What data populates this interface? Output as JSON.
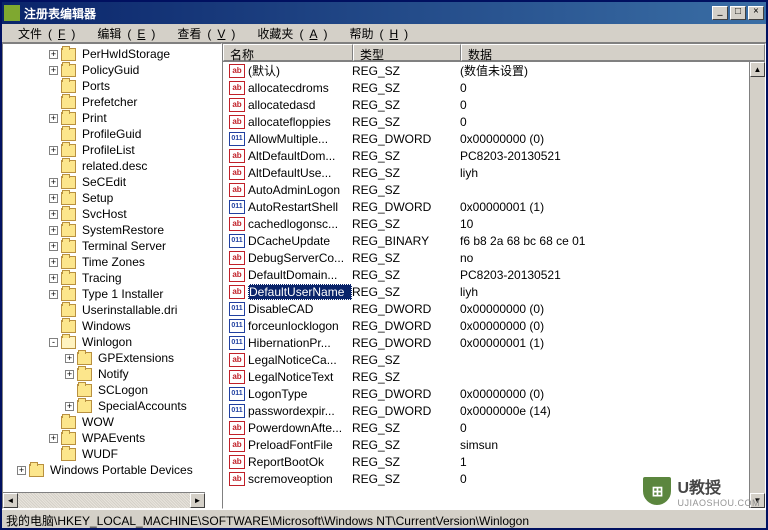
{
  "window": {
    "title": "注册表编辑器",
    "min_btn": "_",
    "max_btn": "□",
    "close_btn": "×"
  },
  "menu": {
    "file": "文件",
    "file_acc": "F",
    "edit": "编辑",
    "edit_acc": "E",
    "view": "查看",
    "view_acc": "V",
    "fav": "收藏夹",
    "fav_acc": "A",
    "help": "帮助",
    "help_acc": "H"
  },
  "columns": {
    "name": "名称",
    "type": "类型",
    "data": "数据"
  },
  "tree": [
    {
      "indent": 46,
      "exp": "+",
      "label": "PerHwIdStorage"
    },
    {
      "indent": 46,
      "exp": "+",
      "label": "PolicyGuid"
    },
    {
      "indent": 46,
      "exp": "",
      "label": "Ports"
    },
    {
      "indent": 46,
      "exp": "",
      "label": "Prefetcher"
    },
    {
      "indent": 46,
      "exp": "+",
      "label": "Print"
    },
    {
      "indent": 46,
      "exp": "",
      "label": "ProfileGuid"
    },
    {
      "indent": 46,
      "exp": "+",
      "label": "ProfileList"
    },
    {
      "indent": 46,
      "exp": "",
      "label": "related.desc"
    },
    {
      "indent": 46,
      "exp": "+",
      "label": "SeCEdit"
    },
    {
      "indent": 46,
      "exp": "+",
      "label": "Setup"
    },
    {
      "indent": 46,
      "exp": "+",
      "label": "SvcHost"
    },
    {
      "indent": 46,
      "exp": "+",
      "label": "SystemRestore"
    },
    {
      "indent": 46,
      "exp": "+",
      "label": "Terminal Server"
    },
    {
      "indent": 46,
      "exp": "+",
      "label": "Time Zones"
    },
    {
      "indent": 46,
      "exp": "+",
      "label": "Tracing"
    },
    {
      "indent": 46,
      "exp": "+",
      "label": "Type 1 Installer"
    },
    {
      "indent": 46,
      "exp": "",
      "label": "Userinstallable.dri"
    },
    {
      "indent": 46,
      "exp": "",
      "label": "Windows"
    },
    {
      "indent": 46,
      "exp": "-",
      "label": "Winlogon",
      "open": true
    },
    {
      "indent": 62,
      "exp": "+",
      "label": "GPExtensions"
    },
    {
      "indent": 62,
      "exp": "+",
      "label": "Notify"
    },
    {
      "indent": 62,
      "exp": "",
      "label": "SCLogon"
    },
    {
      "indent": 62,
      "exp": "+",
      "label": "SpecialAccounts"
    },
    {
      "indent": 46,
      "exp": "",
      "label": "WOW"
    },
    {
      "indent": 46,
      "exp": "+",
      "label": "WPAEvents"
    },
    {
      "indent": 46,
      "exp": "",
      "label": "WUDF"
    },
    {
      "indent": 14,
      "exp": "+",
      "label": "Windows Portable Devices"
    }
  ],
  "values": [
    {
      "icon": "sz",
      "name": "(默认)",
      "type": "REG_SZ",
      "data": "(数值未设置)"
    },
    {
      "icon": "sz",
      "name": "allocatecdroms",
      "type": "REG_SZ",
      "data": "0"
    },
    {
      "icon": "sz",
      "name": "allocatedasd",
      "type": "REG_SZ",
      "data": "0"
    },
    {
      "icon": "sz",
      "name": "allocatefloppies",
      "type": "REG_SZ",
      "data": "0"
    },
    {
      "icon": "dw",
      "name": "AllowMultiple...",
      "type": "REG_DWORD",
      "data": "0x00000000 (0)"
    },
    {
      "icon": "sz",
      "name": "AltDefaultDom...",
      "type": "REG_SZ",
      "data": "PC8203-20130521"
    },
    {
      "icon": "sz",
      "name": "AltDefaultUse...",
      "type": "REG_SZ",
      "data": "liyh"
    },
    {
      "icon": "sz",
      "name": "AutoAdminLogon",
      "type": "REG_SZ",
      "data": ""
    },
    {
      "icon": "dw",
      "name": "AutoRestartShell",
      "type": "REG_DWORD",
      "data": "0x00000001 (1)"
    },
    {
      "icon": "sz",
      "name": "cachedlogonsc...",
      "type": "REG_SZ",
      "data": "10"
    },
    {
      "icon": "dw",
      "name": "DCacheUpdate",
      "type": "REG_BINARY",
      "data": "f6 b8 2a 68 bc 68 ce 01"
    },
    {
      "icon": "sz",
      "name": "DebugServerCo...",
      "type": "REG_SZ",
      "data": "no"
    },
    {
      "icon": "sz",
      "name": "DefaultDomain...",
      "type": "REG_SZ",
      "data": "PC8203-20130521"
    },
    {
      "icon": "sz",
      "name": "DefaultUserName",
      "type": "REG_SZ",
      "data": "liyh",
      "selected": true
    },
    {
      "icon": "dw",
      "name": "DisableCAD",
      "type": "REG_DWORD",
      "data": "0x00000000 (0)"
    },
    {
      "icon": "dw",
      "name": "forceunlocklogon",
      "type": "REG_DWORD",
      "data": "0x00000000 (0)"
    },
    {
      "icon": "dw",
      "name": "HibernationPr...",
      "type": "REG_DWORD",
      "data": "0x00000001 (1)"
    },
    {
      "icon": "sz",
      "name": "LegalNoticeCa...",
      "type": "REG_SZ",
      "data": ""
    },
    {
      "icon": "sz",
      "name": "LegalNoticeText",
      "type": "REG_SZ",
      "data": ""
    },
    {
      "icon": "dw",
      "name": "LogonType",
      "type": "REG_DWORD",
      "data": "0x00000000 (0)"
    },
    {
      "icon": "dw",
      "name": "passwordexpir...",
      "type": "REG_DWORD",
      "data": "0x0000000e (14)"
    },
    {
      "icon": "sz",
      "name": "PowerdownAfte...",
      "type": "REG_SZ",
      "data": "0"
    },
    {
      "icon": "sz",
      "name": "PreloadFontFile",
      "type": "REG_SZ",
      "data": "simsun"
    },
    {
      "icon": "sz",
      "name": "ReportBootOk",
      "type": "REG_SZ",
      "data": "1"
    },
    {
      "icon": "sz",
      "name": "scremoveoption",
      "type": "REG_SZ",
      "data": "0"
    }
  ],
  "status": {
    "path": "我的电脑\\HKEY_LOCAL_MACHINE\\SOFTWARE\\Microsoft\\Windows NT\\CurrentVersion\\Winlogon"
  },
  "watermark": {
    "title": "U教授",
    "url": "UJIAOSHOU.COM"
  }
}
